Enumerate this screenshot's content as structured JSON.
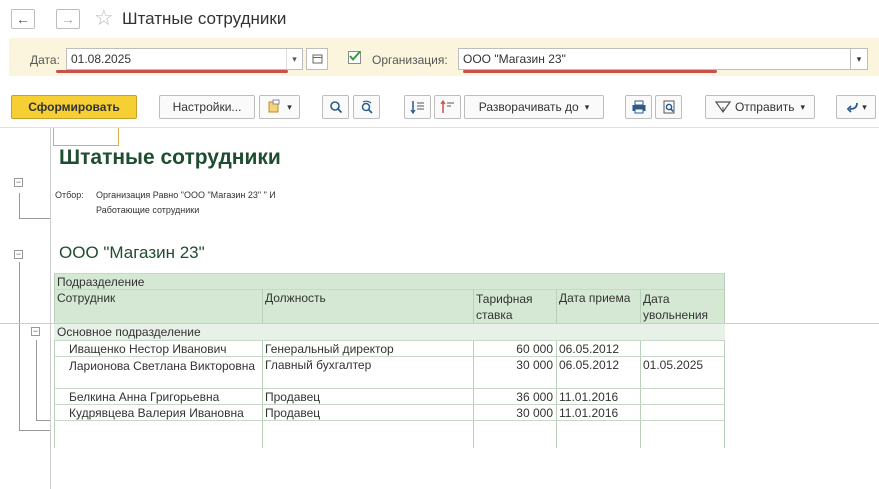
{
  "window": {
    "title": "Штатные сотрудники",
    "back": "←",
    "forward": "→",
    "star": "☆"
  },
  "params": {
    "date_label": "Дата:",
    "date_value": "01.08.2025",
    "org_label": "Организация:",
    "org_value": "ООО \"Магазин 23\"",
    "org_checked": true
  },
  "toolbar": {
    "generate": "Сформировать",
    "settings": "Настройки...",
    "expand_to": "Разворачивать до",
    "send": "Отправить"
  },
  "report": {
    "title": "Штатные сотрудники",
    "filter_label": "Отбор:",
    "filter_line1": "Организация Равно \"ООО \"Магазин 23\" \" И",
    "filter_line2": "Работающие сотрудники",
    "org_heading": "ООО \"Магазин 23\"",
    "table": {
      "group_header": "Подразделение",
      "columns": [
        "Сотрудник",
        "Должность",
        "Тарифная ставка",
        "Дата приема",
        "Дата увольнения"
      ],
      "group": "Основное подразделение",
      "rows": [
        {
          "employee": "Иващенко Нестор Иванович",
          "position": "Генеральный директор",
          "rate": "60 000",
          "hired": "06.05.2012",
          "fired": ""
        },
        {
          "employee": "Ларионова Светлана Викторовна",
          "position": "Главный бухгалтер",
          "rate": "30 000",
          "hired": "06.05.2012",
          "fired": "01.05.2025"
        },
        {
          "employee": "Белкина Анна Григорьевна",
          "position": "Продавец",
          "rate": "36 000",
          "hired": "11.01.2016",
          "fired": ""
        },
        {
          "employee": "Кудрявцева Валерия Ивановна",
          "position": "Продавец",
          "rate": "30 000",
          "hired": "11.01.2016",
          "fired": ""
        }
      ]
    }
  },
  "colors": {
    "accent": "#f6cf34",
    "params_bg": "#fbf5dd",
    "table_header": "#d5e8d4",
    "title_green": "#1f4d2f",
    "underline_red": "#c9514b"
  }
}
